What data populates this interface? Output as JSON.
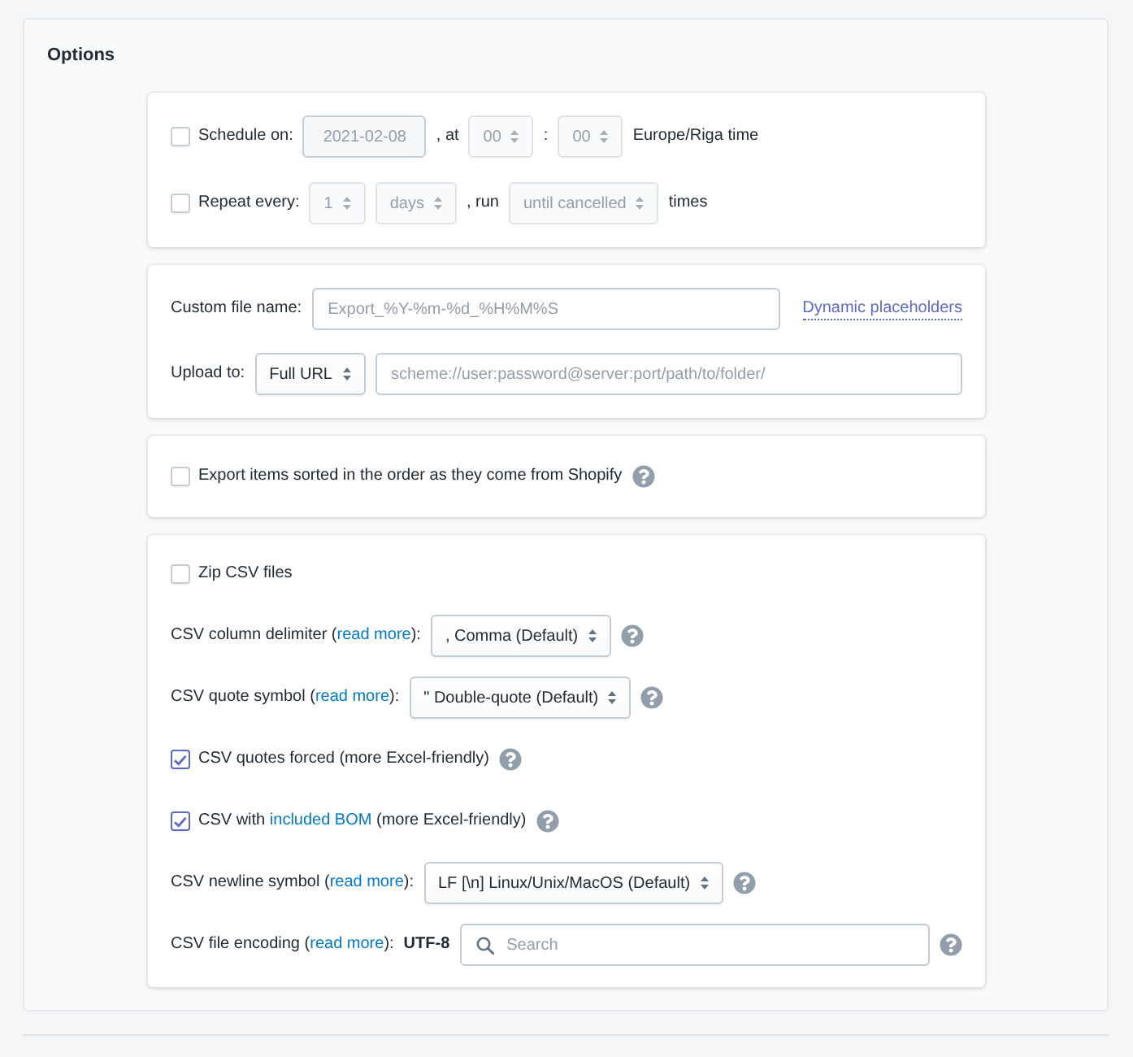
{
  "section": {
    "title": "Options"
  },
  "schedule": {
    "rows": [
      {
        "checked": false,
        "label": "Schedule on:",
        "parts": [
          {
            "kind": "date",
            "value": "2021-02-08",
            "disabled": true
          },
          {
            "kind": "text",
            "text": ", at"
          },
          {
            "kind": "select",
            "value": "00",
            "disabled": true
          },
          {
            "kind": "text",
            "text": ":"
          },
          {
            "kind": "select",
            "value": "00",
            "disabled": true
          },
          {
            "kind": "text",
            "text": "Europe/Riga time"
          }
        ]
      },
      {
        "checked": false,
        "label": "Repeat every:",
        "parts": [
          {
            "kind": "select",
            "value": "1",
            "disabled": true
          },
          {
            "kind": "select",
            "value": "days",
            "disabled": true
          },
          {
            "kind": "text",
            "text": ", run"
          },
          {
            "kind": "select",
            "value": "until cancelled",
            "disabled": true
          },
          {
            "kind": "text",
            "text": "times"
          }
        ]
      }
    ]
  },
  "file_export": {
    "file_name": {
      "label": "Custom file name:",
      "placeholder": "Export_%Y-%m-%d_%H%M%S",
      "link": "Dynamic placeholders"
    },
    "upload": {
      "label": "Upload to:",
      "protocol": {
        "value": "Full URL",
        "disabled": false
      },
      "placeholder": "scheme://user:password@server:port/path/to/folder/"
    }
  },
  "sorting": {
    "checked": false,
    "label": "Export items sorted in the order as they come from Shopify",
    "help": true
  },
  "csv": {
    "rows": [
      {
        "kind": "checkbox",
        "checked": false,
        "label": [
          {
            "text": "Zip CSV files"
          }
        ],
        "help": false
      },
      {
        "kind": "select",
        "label": [
          {
            "text": "CSV column delimiter ("
          },
          {
            "link": "read more"
          },
          {
            "text": "):"
          }
        ],
        "value": ", Comma (Default)",
        "help": true
      },
      {
        "kind": "select",
        "label": [
          {
            "text": "CSV quote symbol ("
          },
          {
            "link": "read more"
          },
          {
            "text": "):"
          }
        ],
        "value": "\" Double-quote (Default)",
        "help": true
      },
      {
        "kind": "checkbox",
        "checked": true,
        "label": [
          {
            "text": "CSV quotes forced (more Excel-friendly)"
          }
        ],
        "help": true
      },
      {
        "kind": "checkbox",
        "checked": true,
        "label": [
          {
            "text": "CSV with "
          },
          {
            "link": "included BOM"
          },
          {
            "text": " (more Excel-friendly)"
          }
        ],
        "help": true
      },
      {
        "kind": "select",
        "label": [
          {
            "text": "CSV newline symbol ("
          },
          {
            "link": "read more"
          },
          {
            "text": "):"
          }
        ],
        "value": "LF [\\n] Linux/Unix/MacOS (Default)",
        "help": true
      },
      {
        "kind": "search",
        "label": [
          {
            "text": "CSV file encoding ("
          },
          {
            "link": "read more"
          },
          {
            "text": "):"
          }
        ],
        "value": "UTF-8",
        "placeholder": "Search",
        "help": true
      }
    ]
  }
}
